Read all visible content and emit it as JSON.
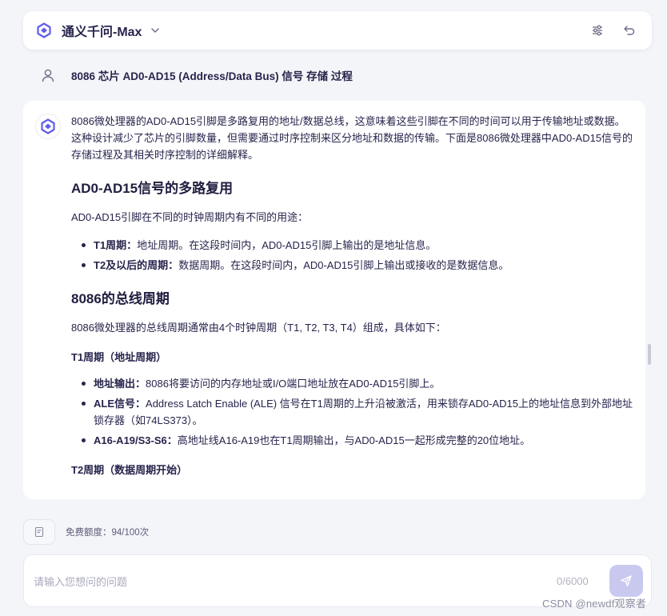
{
  "header": {
    "model_name": "通义千问-Max",
    "icons": [
      "logo-icon",
      "chevron-down-icon",
      "settings-sliders-icon",
      "undo-icon"
    ]
  },
  "user_message": {
    "text": "8086 芯片 AD0-AD15 (Address/Data Bus) 信号 存储 过程",
    "icon": "user-icon"
  },
  "answer": {
    "intro": "8086微处理器的AD0-AD15引脚是多路复用的地址/数据总线，这意味着这些引脚在不同的时间可以用于传输地址或数据。这种设计减少了芯片的引脚数量，但需要通过时序控制来区分地址和数据的传输。下面是8086微处理器中AD0-AD15信号的存储过程及其相关时序控制的详细解释。",
    "section1": {
      "heading": "AD0-AD15信号的多路复用",
      "para": "AD0-AD15引脚在不同的时钟周期内有不同的用途：",
      "items": [
        {
          "label": "T1周期",
          "sep": "：",
          "text": "地址周期。在这段时间内，AD0-AD15引脚上输出的是地址信息。"
        },
        {
          "label": "T2及以后的周期",
          "sep": "：",
          "text": "数据周期。在这段时间内，AD0-AD15引脚上输出或接收的是数据信息。"
        }
      ]
    },
    "section2": {
      "heading": "8086的总线周期",
      "para": "8086微处理器的总线周期通常由4个时钟周期（T1, T2, T3, T4）组成，具体如下：",
      "sub1": {
        "heading": "T1周期（地址周期）",
        "items": [
          {
            "label": "地址输出",
            "sep": "：",
            "text": "8086将要访问的内存地址或I/O端口地址放在AD0-AD15引脚上。"
          },
          {
            "label": "ALE信号",
            "sep": "：",
            "text": "Address Latch Enable (ALE) 信号在T1周期的上升沿被激活，用来锁存AD0-AD15上的地址信息到外部地址锁存器（如74LS373）。"
          },
          {
            "label": "A16-A19/S3-S6",
            "sep": "：",
            "text": "高地址线A16-A19也在T1周期输出，与AD0-AD15一起形成完整的20位地址。"
          }
        ]
      },
      "sub2": {
        "heading": "T2周期（数据周期开始）"
      }
    }
  },
  "footer": {
    "quota_label": "免费额度：94/100次",
    "input_placeholder": "请输入您想问的问题",
    "counter": "0/6000",
    "watermark": "CSDN @newdf观察者"
  }
}
